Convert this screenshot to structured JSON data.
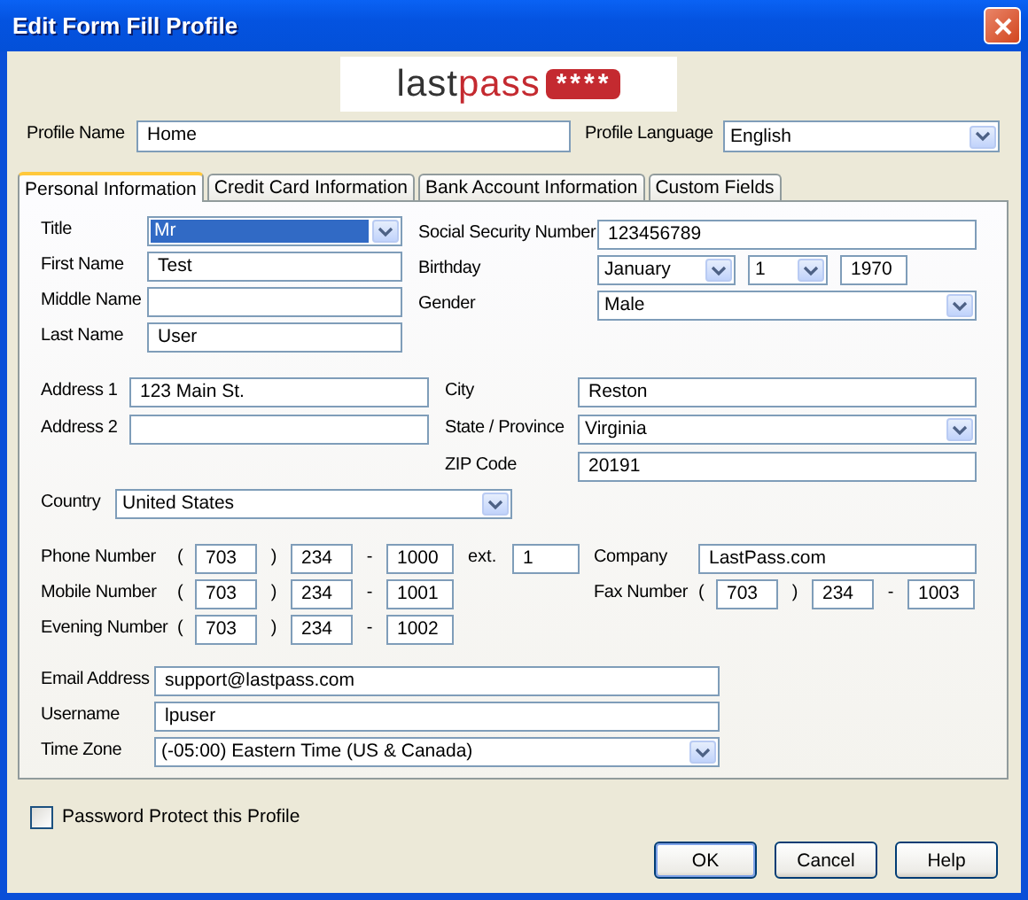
{
  "window": {
    "title": "Edit Form Fill Profile"
  },
  "logo": {
    "wordmark_dark": "last",
    "wordmark_red": "pass",
    "badge": "****"
  },
  "profile": {
    "name_label": "Profile Name",
    "name_value": "Home",
    "language_label": "Profile Language",
    "language_value": "English"
  },
  "tabs": [
    {
      "label": "Personal Information",
      "selected": true
    },
    {
      "label": "Credit Card Information",
      "selected": false
    },
    {
      "label": "Bank Account Information",
      "selected": false
    },
    {
      "label": "Custom Fields",
      "selected": false
    }
  ],
  "left_fields": [
    {
      "label": "Title",
      "kind": "select",
      "value": "Mr",
      "focused": true
    },
    {
      "label": "First Name",
      "kind": "text",
      "value": "Test"
    },
    {
      "label": "Middle Name",
      "kind": "text"
    },
    {
      "label": "Last Name",
      "kind": "text",
      "value": "User"
    }
  ],
  "right_fields": [
    {
      "label": "Social Security Number",
      "kind": "text",
      "value": "123456789"
    },
    {
      "label": "Birthday",
      "kind": "date",
      "month": "January",
      "day": "1",
      "year": "1970"
    },
    {
      "label": "Gender",
      "kind": "select",
      "value": "Male"
    }
  ],
  "address_left": [
    {
      "label": "Address 1",
      "kind": "text",
      "value": "123 Main St."
    },
    {
      "label": "Address 2",
      "kind": "text"
    }
  ],
  "address_right": [
    {
      "label": "City",
      "kind": "text",
      "value": "Reston"
    },
    {
      "label": "State / Province",
      "kind": "select",
      "value": "Virginia"
    },
    {
      "label": "ZIP Code",
      "kind": "text",
      "value": "20191"
    }
  ],
  "country": {
    "label": "Country",
    "value": "United States"
  },
  "phones": [
    {
      "label": "Phone Number",
      "open": "(",
      "area": "703",
      "close": ")",
      "prefix": "234",
      "dash": "-",
      "line": "1000",
      "ext_label": "ext.",
      "ext": "1"
    },
    {
      "label": "Mobile Number",
      "open": "(",
      "area": "703",
      "close": ")",
      "prefix": "234",
      "dash": "-",
      "line": "1001"
    },
    {
      "label": "Evening Number",
      "open": "(",
      "area": "703",
      "close": ")",
      "prefix": "234",
      "dash": "-",
      "line": "1002"
    }
  ],
  "company": {
    "label": "Company",
    "value": "LastPass.com"
  },
  "fax": {
    "label": "Fax Number",
    "open": "(",
    "area": "703",
    "close": ")",
    "prefix": "234",
    "dash": "-",
    "line": "1003"
  },
  "contact": [
    {
      "label": "Email Address",
      "kind": "text",
      "value": "support@lastpass.com"
    },
    {
      "label": "Username",
      "kind": "text",
      "value": "lpuser"
    },
    {
      "label": "Time Zone",
      "kind": "select",
      "value": "(-05:00) Eastern Time (US & Canada)"
    }
  ],
  "password_protect": {
    "label": "Password Protect this Profile",
    "checked": false
  },
  "buttons": [
    {
      "label": "OK",
      "default": true
    },
    {
      "label": "Cancel",
      "default": false
    },
    {
      "label": "Help",
      "default": false
    }
  ]
}
